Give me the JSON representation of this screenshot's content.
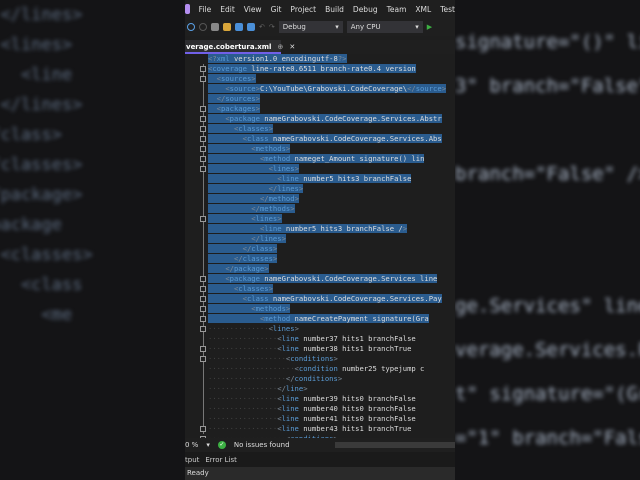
{
  "menu": [
    "File",
    "Edit",
    "View",
    "Git",
    "Project",
    "Build",
    "Debug",
    "Team",
    "XML",
    "Test"
  ],
  "toolbar": {
    "config": "Debug",
    "platform": "Any CPU"
  },
  "tab": {
    "title": "verage.cobertura.xml",
    "pin": "⊕",
    "close": "✕"
  },
  "editor": {
    "selected_lines": 27,
    "lines": [
      [
        0,
        "<?xml version=\"1.0\" encoding=\"utf-8\"?>"
      ],
      [
        0,
        "<coverage line-rate=\"0.6511\" branch-rate=\"0.4\" version=\""
      ],
      [
        1,
        "<sources>"
      ],
      [
        2,
        "<source>C:\\YouTube\\Grabovski.CodeCoverage\\</source>"
      ],
      [
        1,
        "</sources>"
      ],
      [
        1,
        "<packages>"
      ],
      [
        2,
        "<package name=\"Grabovski.CodeCoverage.Services.Abstr"
      ],
      [
        3,
        "<classes>"
      ],
      [
        4,
        "<class name=\"Grabovski.CodeCoverage.Services.Abs"
      ],
      [
        5,
        "<methods>"
      ],
      [
        6,
        "<method name=\"get_Amount\" signature=\"()\" lin"
      ],
      [
        7,
        "<lines>"
      ],
      [
        8,
        "<line number=\"5\" hits=\"3\" branch=\"False\""
      ],
      [
        7,
        "</lines>"
      ],
      [
        6,
        "</method>"
      ],
      [
        5,
        "</methods>"
      ],
      [
        5,
        "<lines>"
      ],
      [
        6,
        "<line number=\"5\" hits=\"3\" branch=\"False\" />"
      ],
      [
        5,
        "</lines>"
      ],
      [
        4,
        "</class>"
      ],
      [
        3,
        "</classes>"
      ],
      [
        2,
        "</package>"
      ],
      [
        2,
        "<package name=\"Grabovski.CodeCoverage.Services\" line"
      ],
      [
        3,
        "<classes>"
      ],
      [
        4,
        "<class name=\"Grabovski.CodeCoverage.Services.Pay"
      ],
      [
        5,
        "<methods>"
      ],
      [
        6,
        "<method name=\"CreatePayment\" signature=\"(Gra"
      ],
      [
        7,
        "<lines>"
      ],
      [
        8,
        "<line number=\"37\" hits=\"1\" branch=\"False"
      ],
      [
        8,
        "<line number=\"38\" hits=\"1\" branch=\"True\""
      ],
      [
        9,
        "<conditions>"
      ],
      [
        10,
        "<condition number=\"25\" type=\"jump\" c"
      ],
      [
        9,
        "</conditions>"
      ],
      [
        8,
        "</line>"
      ],
      [
        8,
        "<line number=\"39\" hits=\"0\" branch=\"False"
      ],
      [
        8,
        "<line number=\"40\" hits=\"0\" branch=\"False"
      ],
      [
        8,
        "<line number=\"41\" hits=\"0\" branch=\"False"
      ],
      [
        8,
        "<line number=\"43\" hits=\"1\" branch=\"True\""
      ],
      [
        9,
        "<conditions>"
      ]
    ],
    "fold_lines": [
      1,
      2,
      5,
      6,
      7,
      8,
      9,
      10,
      11,
      16,
      22,
      23,
      24,
      25,
      26,
      27,
      29,
      30,
      37,
      38
    ]
  },
  "status": {
    "zoom": "0 %",
    "issues": "No issues found"
  },
  "panel_tabs": [
    "tput",
    "Error List"
  ],
  "statusbar": {
    "text": "Ready"
  },
  "blurred_left": [
    "  </lines>",
    "  <lines>",
    "    <line",
    "  </lines>",
    "</class>",
    "</classes>",
    "</package>",
    "<package",
    "  <classes>",
    "    <class",
    "      <me"
  ],
  "blurred_right": [
    "signature=\"()\" lin",
    "3\" branch=\"False\"",
    "",
    "branch=\"False\" />",
    "",
    "",
    "ge.Services\" line",
    "verage.Services.Pay",
    "t\" signature=\"(Gra",
    "=\"1\" branch=\"False"
  ]
}
